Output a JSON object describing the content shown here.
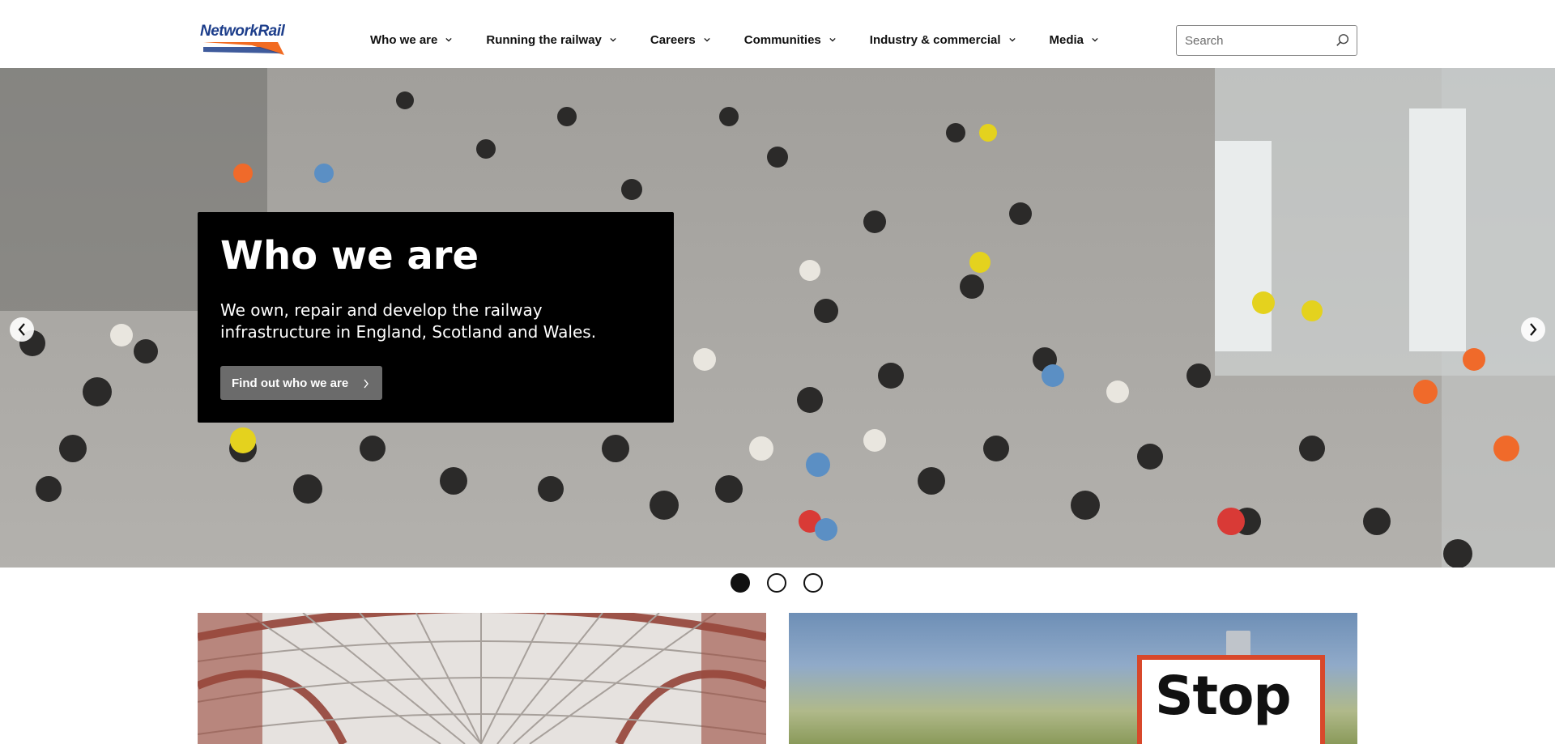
{
  "header": {
    "logo_text": "NetworkRail",
    "nav": [
      {
        "label": "Who we are"
      },
      {
        "label": "Running the railway"
      },
      {
        "label": "Careers"
      },
      {
        "label": "Communities"
      },
      {
        "label": "Industry & commercial"
      },
      {
        "label": "Media"
      }
    ],
    "search": {
      "placeholder": "Search",
      "value": ""
    }
  },
  "hero": {
    "title": "Who we are",
    "description": "We own, repair and develop the railway infrastructure in England, Scotland and Wales.",
    "cta_label": "Find out who we are",
    "slides_total": 3,
    "active_slide": 1
  },
  "cards": {
    "right_sign_text": "Stop"
  },
  "colors": {
    "brand_blue": "#1d3e8b",
    "brand_orange": "#f26b21",
    "panel": "#000000",
    "cta": "#6b6b6b"
  }
}
